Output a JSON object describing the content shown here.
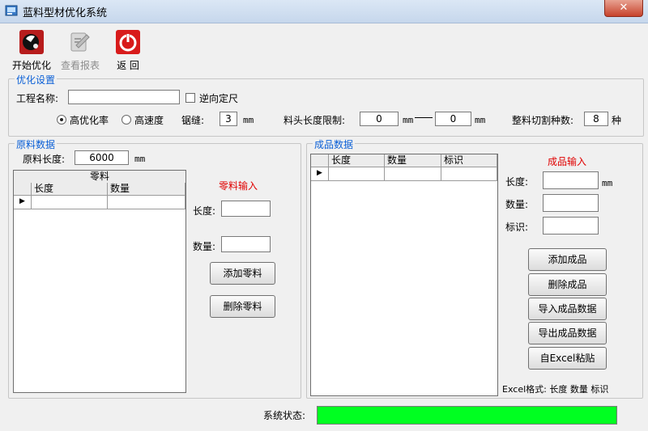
{
  "window": {
    "title": "蓝料型材优化系统",
    "close_glyph": "✕"
  },
  "toolbar": [
    {
      "label": "开始优化"
    },
    {
      "label": "查看报表"
    },
    {
      "label": "返 回"
    }
  ],
  "settings": {
    "legend": "优化设置",
    "project_label": "工程名称:",
    "project_value": "",
    "reverse_label": "逆向定尺",
    "mode_high_rate": "高优化率",
    "mode_high_speed": "高速度",
    "kerf_label": "锯缝:",
    "kerf_value": "3",
    "unit": "mm",
    "stub_label": "料头长度限制:",
    "stub_min": "0",
    "stub_max": "0",
    "cut_label": "整料切割种数:",
    "cut_value": "8",
    "cut_unit": "种"
  },
  "raw": {
    "legend": "原料数据",
    "length_label": "原料长度:",
    "length_value": "6000",
    "unit": "mm",
    "table_caption": "零料",
    "columns": [
      "长度",
      "数量"
    ],
    "input_title": "零料输入",
    "len_label": "长度:",
    "qty_label": "数量:",
    "add_button": "添加零料",
    "delete_button": "删除零料"
  },
  "product": {
    "legend": "成品数据",
    "columns": [
      "长度",
      "数量",
      "标识"
    ],
    "input_title": "成品输入",
    "len_label": "长度:",
    "len_unit": "mm",
    "qty_label": "数量:",
    "tag_label": "标识:",
    "buttons": {
      "add": "添加成品",
      "delete": "删除成品",
      "import": "导入成品数据",
      "export": "导出成品数据",
      "paste": "自Excel粘贴"
    },
    "excel_format": "Excel格式: 长度 数量 标识"
  },
  "status": {
    "label": "系统状态:"
  },
  "colors": {
    "legend": "#0a5fd6",
    "input_title": "#e00000",
    "status_fill": "#00ff21"
  }
}
